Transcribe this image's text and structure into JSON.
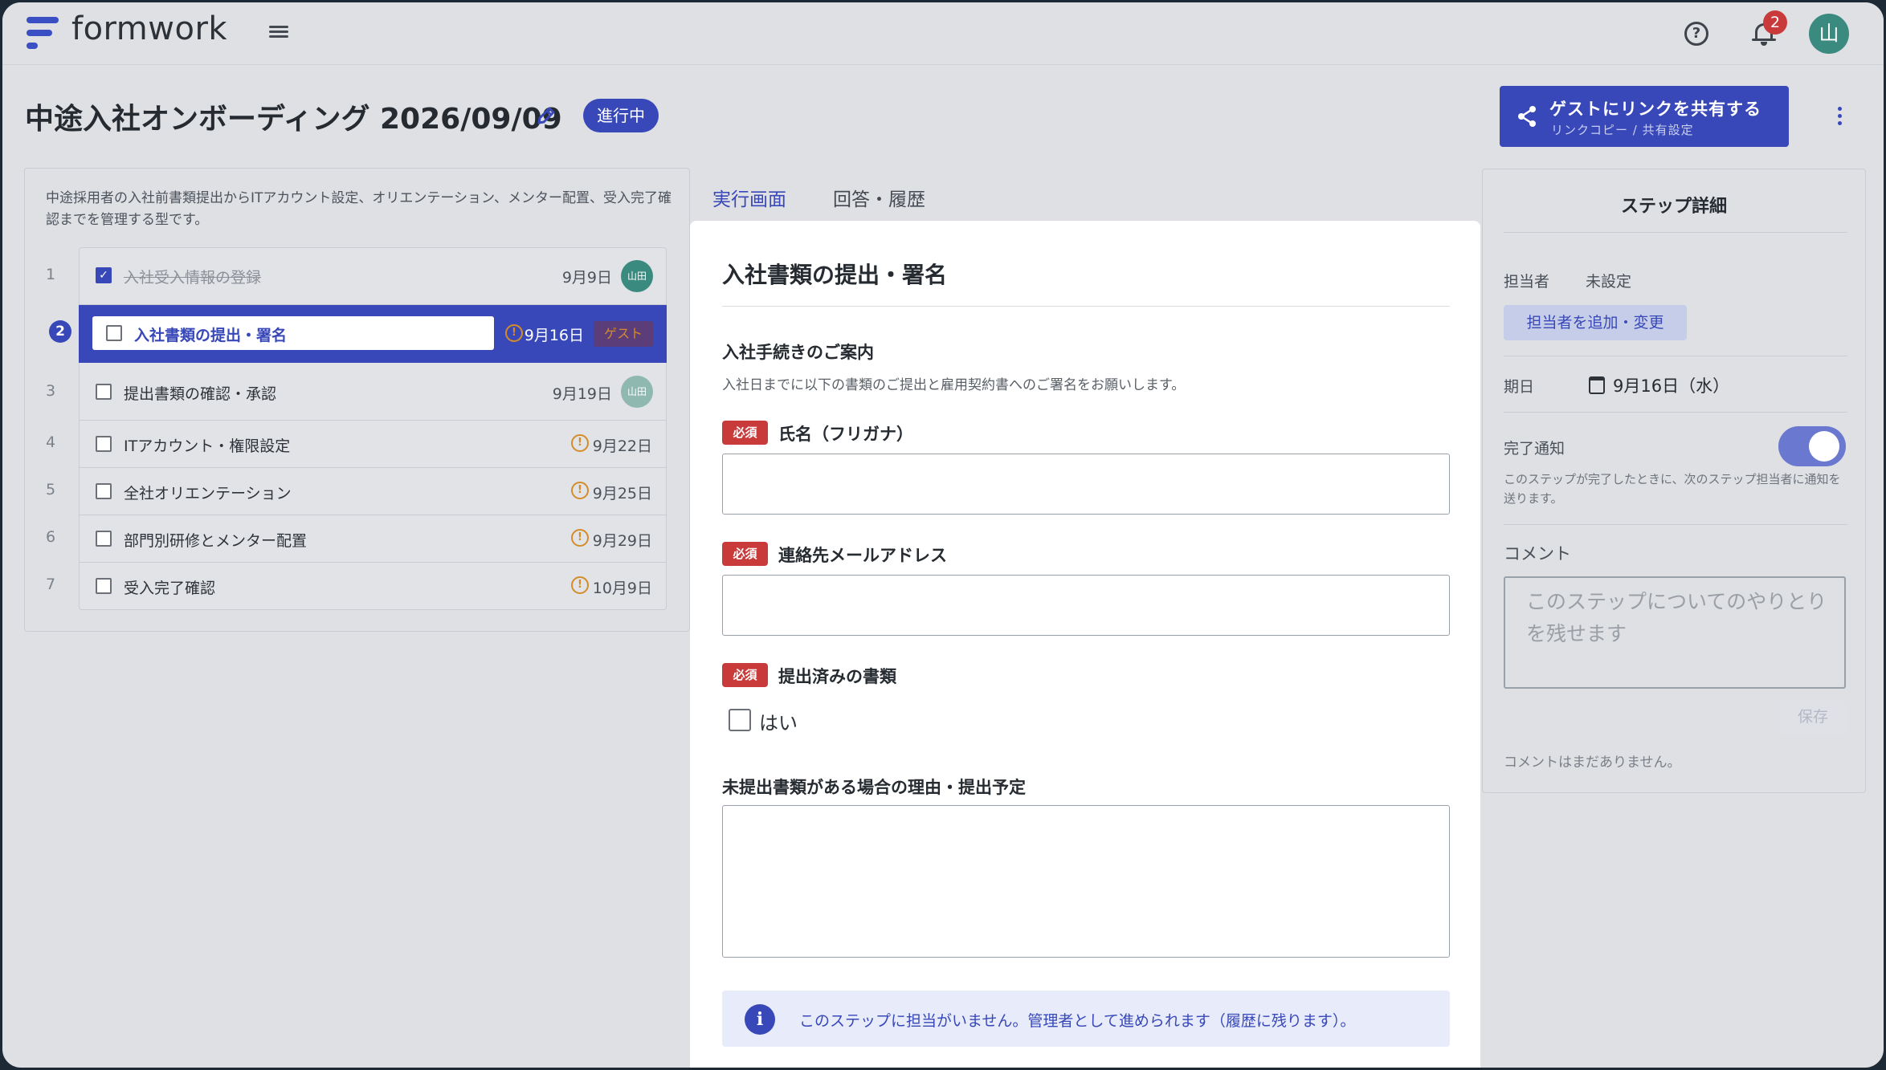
{
  "app": {
    "brand": "formwork",
    "notification_count": "2",
    "user_initial": "山"
  },
  "page": {
    "title": "中途入社オンボーディング 2026/09/09",
    "status": "進行中"
  },
  "share_button": {
    "title": "ゲストにリンクを共有する",
    "subtitle": "リンクコピー / 共有設定"
  },
  "template": {
    "description": "中途採用者の入社前書類提出からITアカウント設定、オリエンテーション、メンター配置、受入完了確認までを管理する型です。"
  },
  "steps": [
    {
      "num": "1",
      "label": "入社受入情報の登録",
      "date": "9月9日",
      "assignee": "山田",
      "done": true
    },
    {
      "num": "2",
      "label": "入社書類の提出・署名",
      "date": "9月16日",
      "assignee": "ゲスト",
      "active": true
    },
    {
      "num": "3",
      "label": "提出書類の確認・承認",
      "date": "9月19日",
      "assignee": "山田"
    },
    {
      "num": "4",
      "label": "ITアカウント・権限設定",
      "date": "9月22日"
    },
    {
      "num": "5",
      "label": "全社オリエンテーション",
      "date": "9月25日"
    },
    {
      "num": "6",
      "label": "部門別研修とメンター配置",
      "date": "9月29日"
    },
    {
      "num": "7",
      "label": "受入完了確認",
      "date": "10月9日"
    }
  ],
  "tabs": [
    "実行画面",
    "回答・履歴"
  ],
  "form": {
    "heading": "入社書類の提出・署名",
    "section_title": "入社手続きのご案内",
    "section_desc": "入社日までに以下の書類のご提出と雇用契約書へのご署名をお願いします。",
    "required_label": "必須",
    "fields": [
      {
        "label": "氏名（フリガナ）",
        "value": ""
      },
      {
        "label": "連絡先メールアドレス",
        "value": ""
      },
      {
        "label": "提出済みの書類",
        "option": "はい"
      },
      {
        "label": "未提出書類がある場合の理由・提出予定",
        "value": ""
      }
    ],
    "info": "このステップに担当がいません。管理者として進められます（履歴に残ります）。"
  },
  "detail": {
    "title": "ステップ詳細",
    "assignee_label": "担当者",
    "assignee_value": "未設定",
    "assign_button": "担当者を追加・変更",
    "due_label": "期日",
    "due_value": "9月16日（水）",
    "notify_label": "完了通知",
    "notify_on": true,
    "notify_desc": "このステップが完了したときに、次のステップ担当者に通知を送ります。",
    "comment_label": "コメント",
    "comment_placeholder": "このステップについてのやりとりを残せます",
    "save_label": "保存",
    "no_comments": "コメントはまだありません。"
  },
  "colors": {
    "accent": "#3848b8",
    "required": "#c93a3a",
    "warning": "#d48c28",
    "avatar": "#3b8a80"
  }
}
